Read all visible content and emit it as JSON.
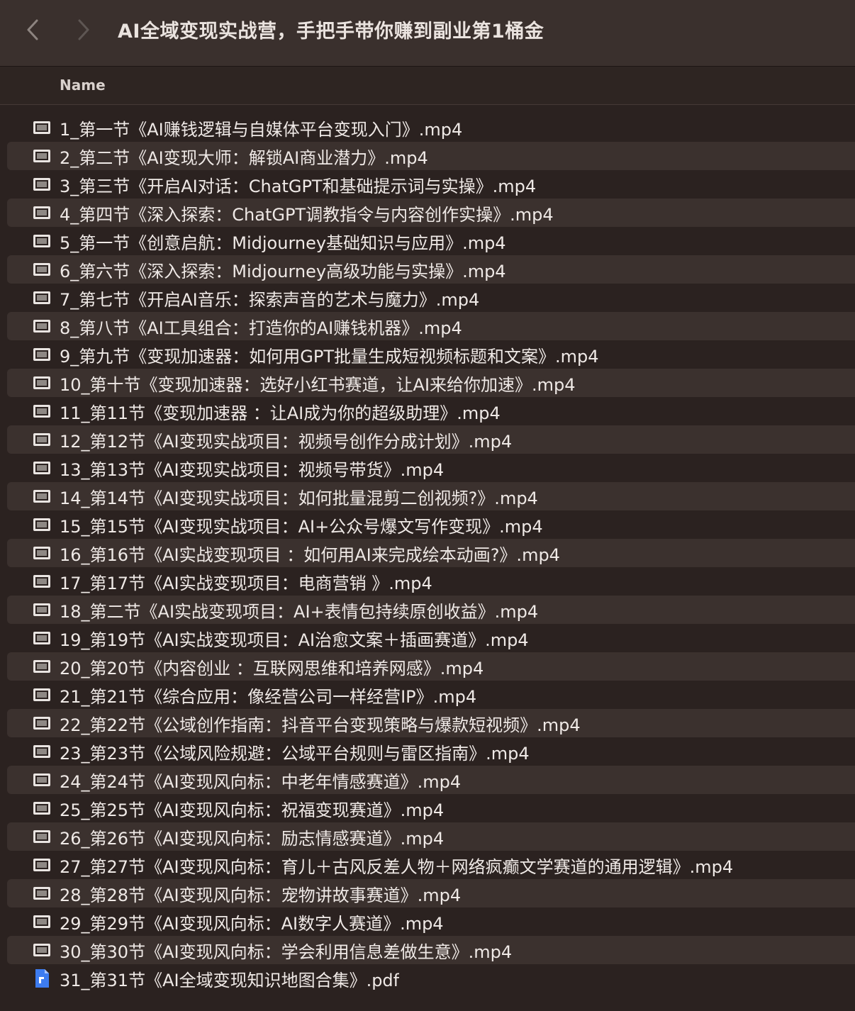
{
  "window": {
    "title": "AI全域变现实战营，手把手带你赚到副业第1桶金"
  },
  "header": {
    "name_column": "Name"
  },
  "files": [
    {
      "name": "1_第一节《AI赚钱逻辑与自媒体平台变现入门》.mp4",
      "icon": "video-file-icon"
    },
    {
      "name": "2_第二节《AI变现大师：解锁AI商业潜力》.mp4",
      "icon": "video-file-icon"
    },
    {
      "name": "3_第三节《开启AI对话：ChatGPT和基础提示词与实操》.mp4",
      "icon": "video-file-icon"
    },
    {
      "name": "4_第四节《深入探索：ChatGPT调教指令与内容创作实操》.mp4",
      "icon": "video-file-icon"
    },
    {
      "name": "5_第一节《创意启航：Midjourney基础知识与应用》.mp4",
      "icon": "video-file-icon"
    },
    {
      "name": "6_第六节《深入探索：Midjourney高级功能与实操》.mp4",
      "icon": "video-file-icon"
    },
    {
      "name": "7_第七节《开启AI音乐：探索声音的艺术与魔力》.mp4",
      "icon": "video-file-icon"
    },
    {
      "name": "8_第八节《AI工具组合：打造你的AI赚钱机器》.mp4",
      "icon": "video-file-icon"
    },
    {
      "name": "9_第九节《变现加速器：如何用GPT批量生成短视频标题和文案》.mp4",
      "icon": "video-file-icon"
    },
    {
      "name": "10_第十节《变现加速器：选好小红书赛道，让AI来给你加速》.mp4",
      "icon": "video-file-icon"
    },
    {
      "name": "11_第11节《变现加速器 ：让AI成为你的超级助理》.mp4",
      "icon": "video-file-icon"
    },
    {
      "name": "12_第12节《AI变现实战项目：视频号创作分成计划》.mp4",
      "icon": "video-file-icon"
    },
    {
      "name": "13_第13节《AI变现实战项目：视频号带货》.mp4",
      "icon": "video-file-icon"
    },
    {
      "name": "14_第14节《AI变现实战项目：如何批量混剪二创视频?》.mp4",
      "icon": "video-file-icon"
    },
    {
      "name": "15_第15节《AI变现实战项目：AI+公众号爆文写作变现》.mp4",
      "icon": "video-file-icon"
    },
    {
      "name": "16_第16节《AI实战变现项目 ：如何用AI来完成绘本动画?》.mp4",
      "icon": "video-file-icon"
    },
    {
      "name": "17_第17节《AI实战变现项目：电商营销 》.mp4",
      "icon": "video-file-icon"
    },
    {
      "name": "18_第二节《AI实战变现项目：AI+表情包持续原创收益》.mp4",
      "icon": "video-file-icon"
    },
    {
      "name": "19_第19节《AI实战变现项目：AI治愈文案＋插画赛道》.mp4",
      "icon": "video-file-icon"
    },
    {
      "name": "20_第20节《内容创业 ：互联网思维和培养网感》.mp4",
      "icon": "video-file-icon"
    },
    {
      "name": "21_第21节《综合应用：像经营公司一样经营IP》.mp4",
      "icon": "video-file-icon"
    },
    {
      "name": "22_第22节《公域创作指南：抖音平台变现策略与爆款短视频》.mp4",
      "icon": "video-file-icon"
    },
    {
      "name": "23_第23节《公域风险规避：公域平台规则与雷区指南》.mp4",
      "icon": "video-file-icon"
    },
    {
      "name": "24_第24节《AI变现风向标：中老年情感赛道》.mp4",
      "icon": "video-file-icon"
    },
    {
      "name": "25_第25节《AI变现风向标：祝福变现赛道》.mp4",
      "icon": "video-file-icon"
    },
    {
      "name": "26_第26节《AI变现风向标：励志情感赛道》.mp4",
      "icon": "video-file-icon"
    },
    {
      "name": "27_第27节《AI变现风向标：育儿＋古风反差人物＋网络疯癫文学赛道的通用逻辑》.mp4",
      "icon": "video-file-icon"
    },
    {
      "name": "28_第28节《AI变现风向标：宠物讲故事赛道》.mp4",
      "icon": "video-file-icon"
    },
    {
      "name": "29_第29节《AI变现风向标：AI数字人赛道》.mp4",
      "icon": "video-file-icon"
    },
    {
      "name": "30_第30节《AI变现风向标：学会利用信息差做生意》.mp4",
      "icon": "video-file-icon"
    },
    {
      "name": "31_第31节《AI全域变现知识地图合集》.pdf",
      "icon": "pdf-file-icon"
    }
  ]
}
